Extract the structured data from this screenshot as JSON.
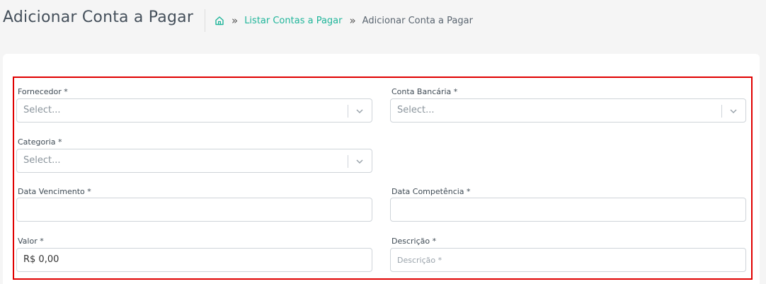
{
  "header": {
    "title": "Adicionar Conta a Pagar",
    "breadcrumb": {
      "home_icon": "home-icon",
      "separator": "»",
      "link_label": "Listar Contas a Pagar",
      "current_label": "Adicionar Conta a Pagar"
    }
  },
  "form": {
    "fornecedor": {
      "label": "Fornecedor *",
      "placeholder": "Select..."
    },
    "conta_bancaria": {
      "label": "Conta Bancária *",
      "placeholder": "Select..."
    },
    "categoria": {
      "label": "Categoria *",
      "placeholder": "Select..."
    },
    "data_vencimento": {
      "label": "Data Vencimento *",
      "value": ""
    },
    "data_competencia": {
      "label": "Data Competência *",
      "value": ""
    },
    "valor": {
      "label": "Valor *",
      "value": "R$ 0,00"
    },
    "descricao": {
      "label": "Descrição *",
      "placeholder": "Descrição *"
    }
  },
  "colors": {
    "accent": "#1fb59a",
    "highlight_border": "#e00000"
  }
}
